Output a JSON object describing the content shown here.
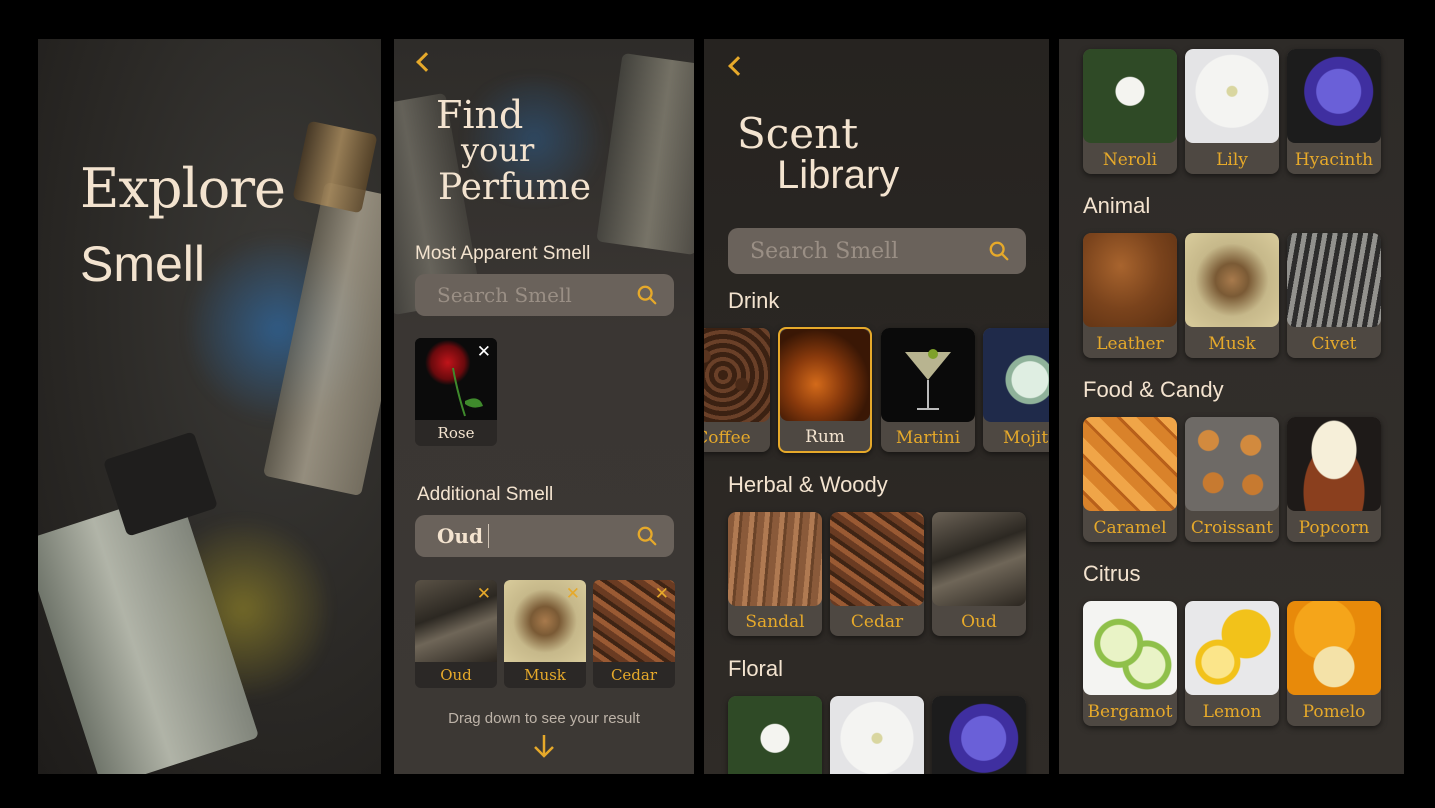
{
  "colors": {
    "accent": "#e6a92a",
    "cream": "#f3e3cf",
    "search_bg": "#6a625b",
    "card_bg": "#4e4842"
  },
  "panel1": {
    "title_line1": "Explore",
    "title_line2": "Smell"
  },
  "panel2": {
    "title_line1": "Find",
    "title_line2": "your",
    "title_line3": "Perfume",
    "most_apparent_label": "Most Apparent Smell",
    "search_placeholder": "Search Smell",
    "apparent_selected": [
      {
        "label": "Rose",
        "remove": "✕"
      }
    ],
    "additional_label": "Additional Smell",
    "additional_value": "Oud",
    "additional_selected": [
      {
        "label": "Oud",
        "remove": "✕"
      },
      {
        "label": "Musk",
        "remove": "✕"
      },
      {
        "label": "Cedar",
        "remove": "✕"
      }
    ],
    "hint": "Drag down to see your result",
    "hint_icon": "arrow-down-icon"
  },
  "panel3": {
    "title_line1": "Scent",
    "title_line2": "Library",
    "search_placeholder": "Search Smell",
    "sections": {
      "drink": {
        "title": "Drink",
        "items": [
          "Coffee",
          "Rum",
          "Martini",
          "Mojito"
        ],
        "selected": "Rum"
      },
      "herbal": {
        "title": "Herbal & Woody",
        "items": [
          "Sandal",
          "Cedar",
          "Oud"
        ]
      },
      "floral": {
        "title": "Floral"
      }
    }
  },
  "panel4": {
    "floral_items": [
      "Neroli",
      "Lily",
      "Hyacinth"
    ],
    "sections": {
      "animal": {
        "title": "Animal",
        "items": [
          "Leather",
          "Musk",
          "Civet"
        ]
      },
      "food": {
        "title": "Food & Candy",
        "items": [
          "Caramel",
          "Croissant",
          "Popcorn"
        ]
      },
      "citrus": {
        "title": "Citrus",
        "items": [
          "Bergamot",
          "Lemon",
          "Pomelo"
        ]
      }
    }
  }
}
